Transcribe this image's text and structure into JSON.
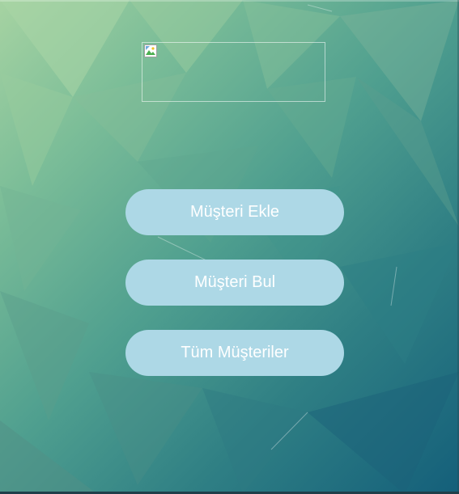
{
  "logo": {
    "icon": "broken-image-icon"
  },
  "menu": {
    "add_customer_label": "Müşteri Ekle",
    "find_customer_label": "Müşteri Bul",
    "all_customers_label": "Tüm Müşteriler"
  },
  "colors": {
    "button_background": "#add8e6",
    "button_text": "#ffffff",
    "background_light": "#a6d3a2",
    "background_dark": "#145f7a"
  }
}
